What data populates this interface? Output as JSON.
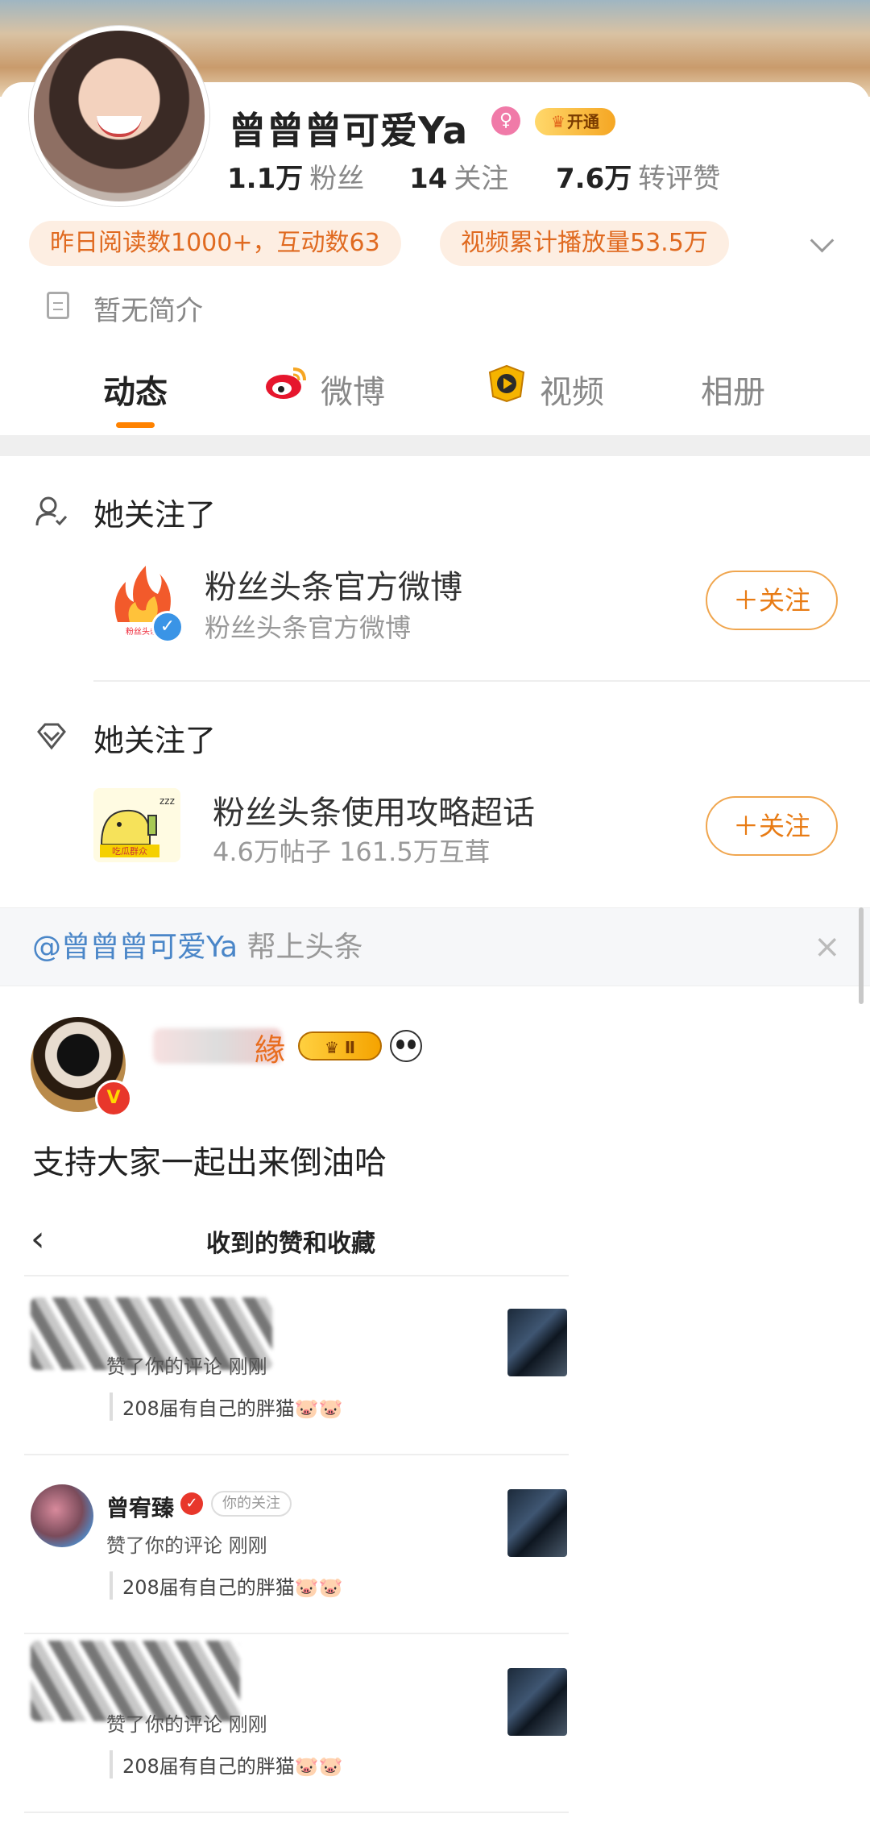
{
  "profile": {
    "name": "曾曾曾可爱Ya",
    "open_badge": "开通",
    "stats": [
      {
        "num": "1.1万",
        "label": "粉丝"
      },
      {
        "num": "14",
        "label": "关注"
      },
      {
        "num": "7.6万",
        "label": "转评赞"
      }
    ],
    "pills": [
      "昨日阅读数1000+，互动数63",
      "视频累计播放量53.5万"
    ],
    "bio": "暂无简介"
  },
  "tabs": [
    "动态",
    "微博",
    "视频",
    "相册"
  ],
  "follows": [
    {
      "heading": "她关注了",
      "name": "粉丝头条官方微博",
      "sub": "粉丝头条官方微博",
      "button": "＋关注",
      "logo_text": "粉丝头条"
    },
    {
      "heading": "她关注了",
      "name": "粉丝头条使用攻略超话",
      "sub": "4.6万帖子 161.5万互茸",
      "button": "＋关注",
      "logo_text": "吃瓜群众"
    }
  ],
  "share_bar": {
    "mention": "@曾曾曾可爱Ya",
    "text": " 帮上头条",
    "close": "×"
  },
  "post": {
    "author_suffix": "緣",
    "level": "Ⅱ",
    "v_badge": "V",
    "text": "支持大家一起出来倒油哈"
  },
  "embedded": {
    "back": "‹",
    "title": "收到的赞和收藏",
    "items": [
      {
        "name": "",
        "tag": "",
        "action": "赞了你的评论  刚刚",
        "quote": "208届有自己的胖猫🐷🐷"
      },
      {
        "name": "曾宥臻",
        "tag": "你的关注",
        "action": "赞了你的评论  刚刚",
        "quote": "208届有自己的胖猫🐷🐷"
      },
      {
        "name": "",
        "tag": "",
        "action": "赞了你的评论  刚刚",
        "quote": "208届有自己的胖猫🐷🐷"
      }
    ]
  },
  "colors": {
    "accent": "#ff8200",
    "follow_border": "#f0a64f",
    "link": "#4a86c8"
  }
}
